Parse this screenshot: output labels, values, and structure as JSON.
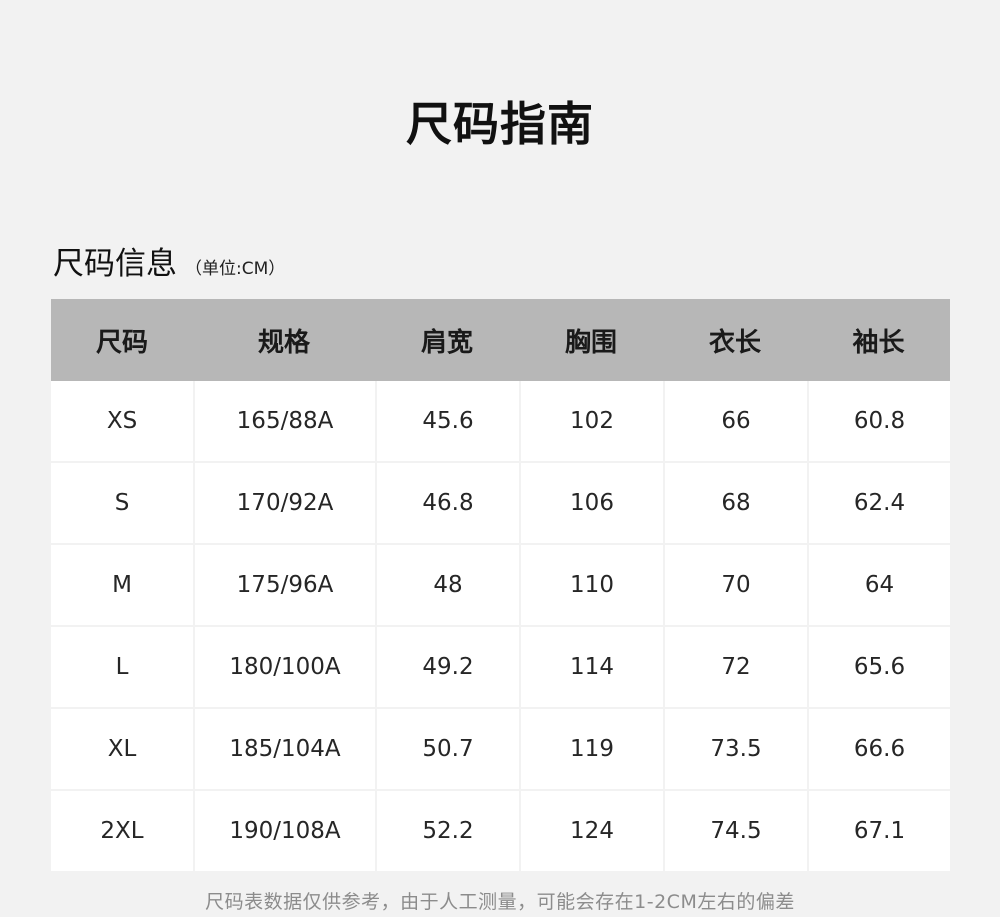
{
  "page": {
    "title": "尺码指南"
  },
  "section": {
    "title": "尺码信息",
    "unit": "（单位:CM）"
  },
  "table": {
    "headers": [
      "尺码",
      "规格",
      "肩宽",
      "胸围",
      "衣长",
      "袖长"
    ],
    "rows": [
      [
        "XS",
        "165/88A",
        "45.6",
        "102",
        "66",
        "60.8"
      ],
      [
        "S",
        "170/92A",
        "46.8",
        "106",
        "68",
        "62.4"
      ],
      [
        "M",
        "175/96A",
        "48",
        "110",
        "70",
        "64"
      ],
      [
        "L",
        "180/100A",
        "49.2",
        "114",
        "72",
        "65.6"
      ],
      [
        "XL",
        "185/104A",
        "50.7",
        "119",
        "73.5",
        "66.6"
      ],
      [
        "2XL",
        "190/108A",
        "52.2",
        "124",
        "74.5",
        "67.1"
      ]
    ]
  },
  "footnote": "尺码表数据仅供参考，由于人工测量，可能会存在1-2CM左右的偏差"
}
